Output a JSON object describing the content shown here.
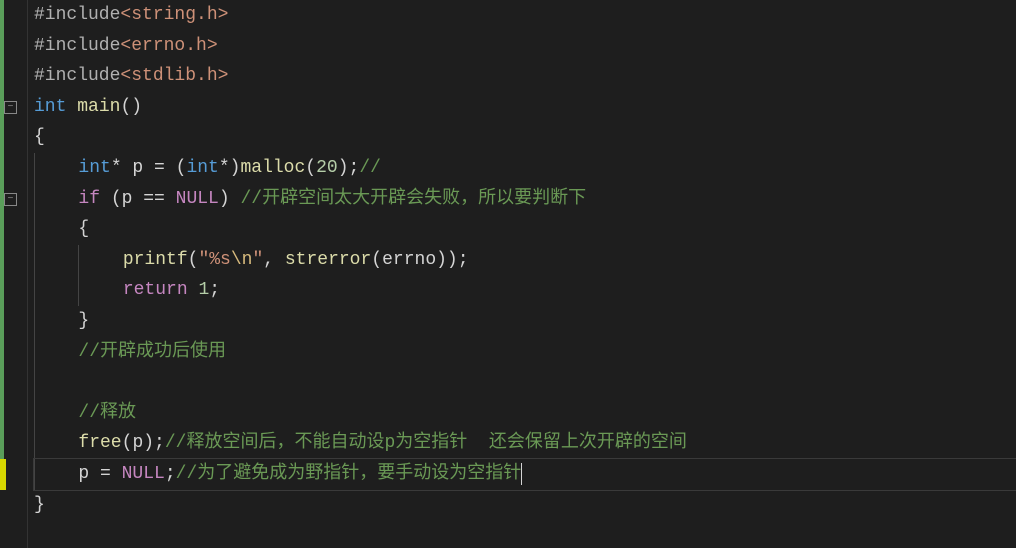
{
  "code": {
    "lines": [
      {
        "indent": 0,
        "segs": [
          {
            "t": "#include",
            "c": "kw-preproc"
          },
          {
            "t": "<string.h>",
            "c": "str"
          }
        ]
      },
      {
        "indent": 0,
        "segs": [
          {
            "t": "#include",
            "c": "kw-preproc"
          },
          {
            "t": "<errno.h>",
            "c": "str"
          }
        ]
      },
      {
        "indent": 0,
        "segs": [
          {
            "t": "#include",
            "c": "kw-preproc"
          },
          {
            "t": "<stdlib.h>",
            "c": "str"
          }
        ]
      },
      {
        "indent": 0,
        "segs": [
          {
            "t": "int",
            "c": "kw-blue"
          },
          {
            "t": " ",
            "c": ""
          },
          {
            "t": "main",
            "c": "func"
          },
          {
            "t": "()",
            "c": "paren"
          }
        ],
        "fold": true
      },
      {
        "indent": 0,
        "segs": [
          {
            "t": "{",
            "c": "paren"
          }
        ]
      },
      {
        "indent": 1,
        "segs": [
          {
            "t": "int",
            "c": "kw-blue"
          },
          {
            "t": "* ",
            "c": "op"
          },
          {
            "t": "p",
            "c": "ident"
          },
          {
            "t": " = (",
            "c": "op"
          },
          {
            "t": "int",
            "c": "kw-blue"
          },
          {
            "t": "*)",
            "c": "op"
          },
          {
            "t": "malloc",
            "c": "func"
          },
          {
            "t": "(",
            "c": "paren"
          },
          {
            "t": "20",
            "c": "num"
          },
          {
            "t": ");",
            "c": "paren"
          },
          {
            "t": "//",
            "c": "comment"
          }
        ]
      },
      {
        "indent": 1,
        "segs": [
          {
            "t": "if",
            "c": "kw-flow"
          },
          {
            "t": " (",
            "c": "paren"
          },
          {
            "t": "p",
            "c": "ident"
          },
          {
            "t": " == ",
            "c": "op"
          },
          {
            "t": "NULL",
            "c": "macro"
          },
          {
            "t": ") ",
            "c": "paren"
          },
          {
            "t": "//开辟空间太大开辟会失败，所以要判断下",
            "c": "comment"
          }
        ],
        "fold": true
      },
      {
        "indent": 1,
        "segs": [
          {
            "t": "{",
            "c": "paren"
          }
        ]
      },
      {
        "indent": 2,
        "segs": [
          {
            "t": "printf",
            "c": "func"
          },
          {
            "t": "(",
            "c": "paren"
          },
          {
            "t": "\"%s",
            "c": "str"
          },
          {
            "t": "\\n",
            "c": "esc"
          },
          {
            "t": "\"",
            "c": "str"
          },
          {
            "t": ", ",
            "c": "op"
          },
          {
            "t": "strerror",
            "c": "func"
          },
          {
            "t": "(",
            "c": "paren"
          },
          {
            "t": "errno",
            "c": "ident"
          },
          {
            "t": "));",
            "c": "paren"
          }
        ]
      },
      {
        "indent": 2,
        "segs": [
          {
            "t": "return",
            "c": "kw-flow"
          },
          {
            "t": " ",
            "c": ""
          },
          {
            "t": "1",
            "c": "num"
          },
          {
            "t": ";",
            "c": "paren"
          }
        ]
      },
      {
        "indent": 1,
        "segs": [
          {
            "t": "}",
            "c": "paren"
          }
        ]
      },
      {
        "indent": 1,
        "segs": [
          {
            "t": "//开辟成功后使用",
            "c": "comment"
          }
        ]
      },
      {
        "indent": 1,
        "segs": []
      },
      {
        "indent": 1,
        "segs": [
          {
            "t": "//释放",
            "c": "comment"
          }
        ]
      },
      {
        "indent": 1,
        "segs": [
          {
            "t": "free",
            "c": "func"
          },
          {
            "t": "(",
            "c": "paren"
          },
          {
            "t": "p",
            "c": "ident"
          },
          {
            "t": ");",
            "c": "paren"
          },
          {
            "t": "//释放空间后，不能自动设p为空指针  还会保留上次开辟的空间",
            "c": "comment"
          }
        ]
      },
      {
        "indent": 1,
        "segs": [
          {
            "t": "p",
            "c": "ident"
          },
          {
            "t": " = ",
            "c": "op"
          },
          {
            "t": "NULL",
            "c": "macro"
          },
          {
            "t": ";",
            "c": "paren"
          },
          {
            "t": "//为了避免成为野指针，要手动设为空指针",
            "c": "comment"
          }
        ],
        "current": true,
        "caret": true
      },
      {
        "indent": 0,
        "segs": [
          {
            "t": "}",
            "c": "paren"
          }
        ]
      }
    ]
  },
  "foldGlyph": "−"
}
